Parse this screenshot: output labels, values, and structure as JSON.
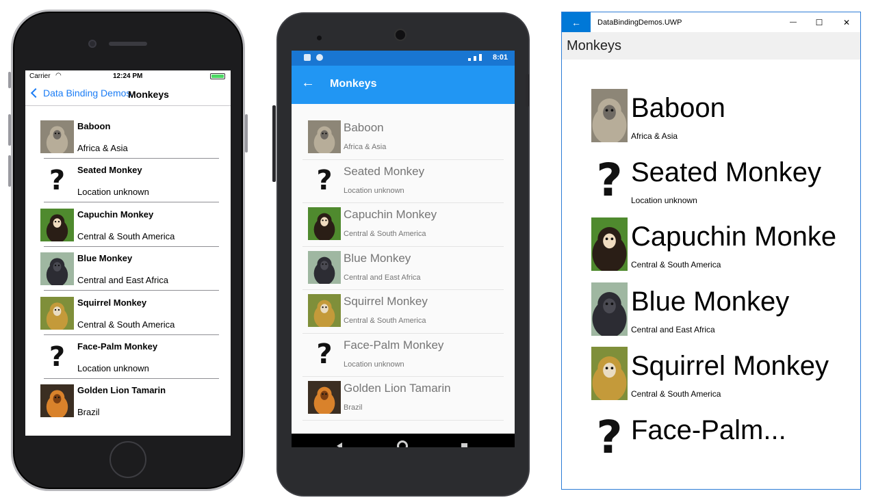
{
  "ios": {
    "status": {
      "carrier": "Carrier",
      "time": "12:24 PM"
    },
    "nav": {
      "back_label": "Data Binding Demos",
      "title": "Monkeys"
    }
  },
  "android": {
    "status": {
      "time": "8:01"
    },
    "appbar": {
      "title": "Monkeys"
    }
  },
  "uwp": {
    "window_title": "DataBindingDemos.UWP",
    "page_title": "Monkeys",
    "min_glyph": "—",
    "max_glyph": "☐",
    "close_glyph": "✕",
    "back_glyph": "←"
  },
  "monkeys": [
    {
      "name": "Baboon",
      "location": "Africa & Asia",
      "image": "baboon"
    },
    {
      "name": "Seated Monkey",
      "location": "Location unknown",
      "image": "unknown"
    },
    {
      "name": "Capuchin Monkey",
      "location": "Central & South America",
      "image": "capuchin"
    },
    {
      "name": "Blue Monkey",
      "location": "Central and East Africa",
      "image": "blue"
    },
    {
      "name": "Squirrel Monkey",
      "location": "Central & South America",
      "image": "squirrel"
    },
    {
      "name": "Face-Palm Monkey",
      "location": "Location unknown",
      "image": "unknown"
    },
    {
      "name": "Golden Lion Tamarin",
      "location": "Brazil",
      "image": "tamarin"
    }
  ],
  "uwp_last_truncated": "Face-Palm...",
  "uwp_row3_name": "Capuchin Monke"
}
